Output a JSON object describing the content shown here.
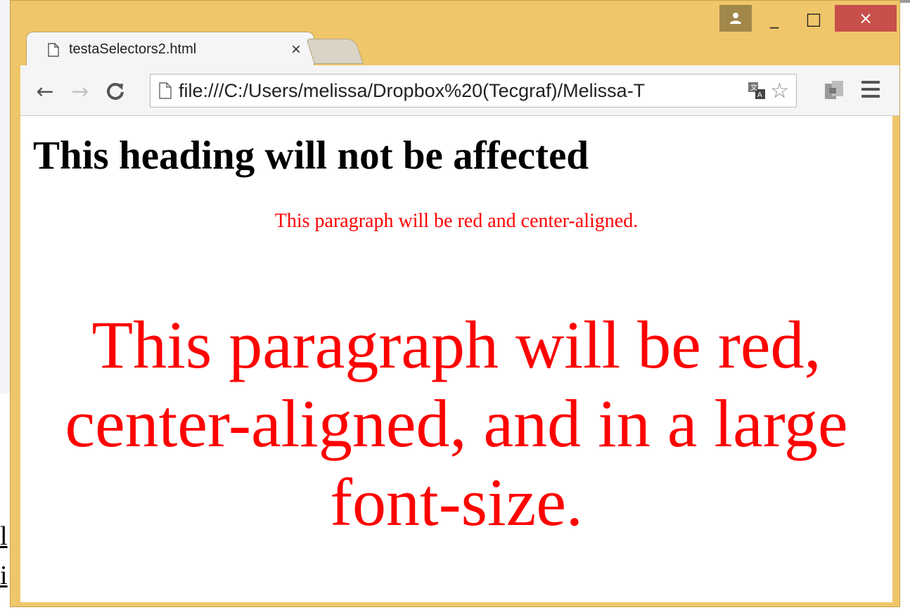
{
  "browser": {
    "tab": {
      "title": "testaSelectors2.html",
      "close_glyph": "×"
    },
    "new_tab_button": "new-tab",
    "caption": {
      "user_icon": "user-icon",
      "minimize_glyph": "_",
      "maximize_glyph": "□",
      "close_glyph": "×"
    },
    "toolbar": {
      "back_glyph": "←",
      "forward_glyph": "→",
      "reload_glyph": "C",
      "url": "file:///C:/Users/melissa/Dropbox%20(Tecgraf)/Melissa-T",
      "star_glyph": "☆"
    }
  },
  "page": {
    "heading": "This heading will not be affected",
    "para_small": "This paragraph will be red and center-aligned.",
    "para_large": "This paragraph will be red, center-aligned, and in a large font-size."
  },
  "background": {
    "text_line1": "l",
    "text_line2": "i"
  },
  "colors": {
    "frame": "#efc66a",
    "close_button": "#c7504a",
    "paragraph_red": "#ff0000"
  }
}
